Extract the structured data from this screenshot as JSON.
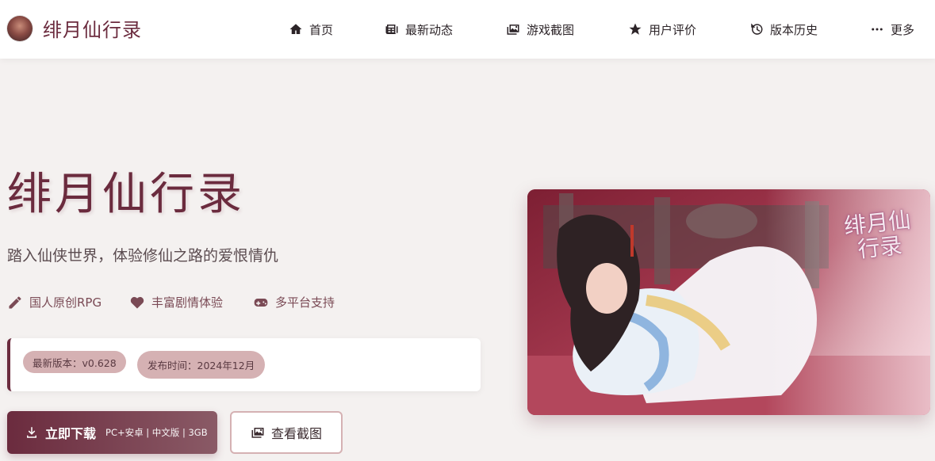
{
  "brand": {
    "title": "绯月仙行录"
  },
  "nav": {
    "home": {
      "label": "首页",
      "icon": "home-icon"
    },
    "news": {
      "label": "最新动态",
      "icon": "newspaper-icon"
    },
    "screenshots": {
      "label": "游戏截图",
      "icon": "images-icon"
    },
    "reviews": {
      "label": "用户评价",
      "icon": "star-icon"
    },
    "history": {
      "label": "版本历史",
      "icon": "history-icon"
    },
    "more": {
      "label": "更多",
      "icon": "ellipsis-icon"
    }
  },
  "hero": {
    "title": "绯月仙行录",
    "subtitle": "踏入仙侠世界，体验修仙之路的爱恨情仇",
    "features": [
      {
        "label": "国人原创RPG",
        "icon": "pencil-icon"
      },
      {
        "label": "丰富剧情体验",
        "icon": "heart-icon"
      },
      {
        "label": "多平台支持",
        "icon": "gamepad-icon"
      }
    ],
    "version_badge": "最新版本：v0.628",
    "release_badge": "发布时间：2024年12月",
    "download_button": {
      "label": "立即下载",
      "details": "PC+安卓 | 中文版 | 3GB",
      "icon": "download-icon"
    },
    "screenshots_button": {
      "label": "查看截图",
      "icon": "images-icon"
    },
    "image_logo": "绯月仙行录"
  },
  "colors": {
    "accent": "#6b2b3e",
    "badge_bg": "#d5b1b3",
    "page_bg": "#f4f1f0"
  }
}
